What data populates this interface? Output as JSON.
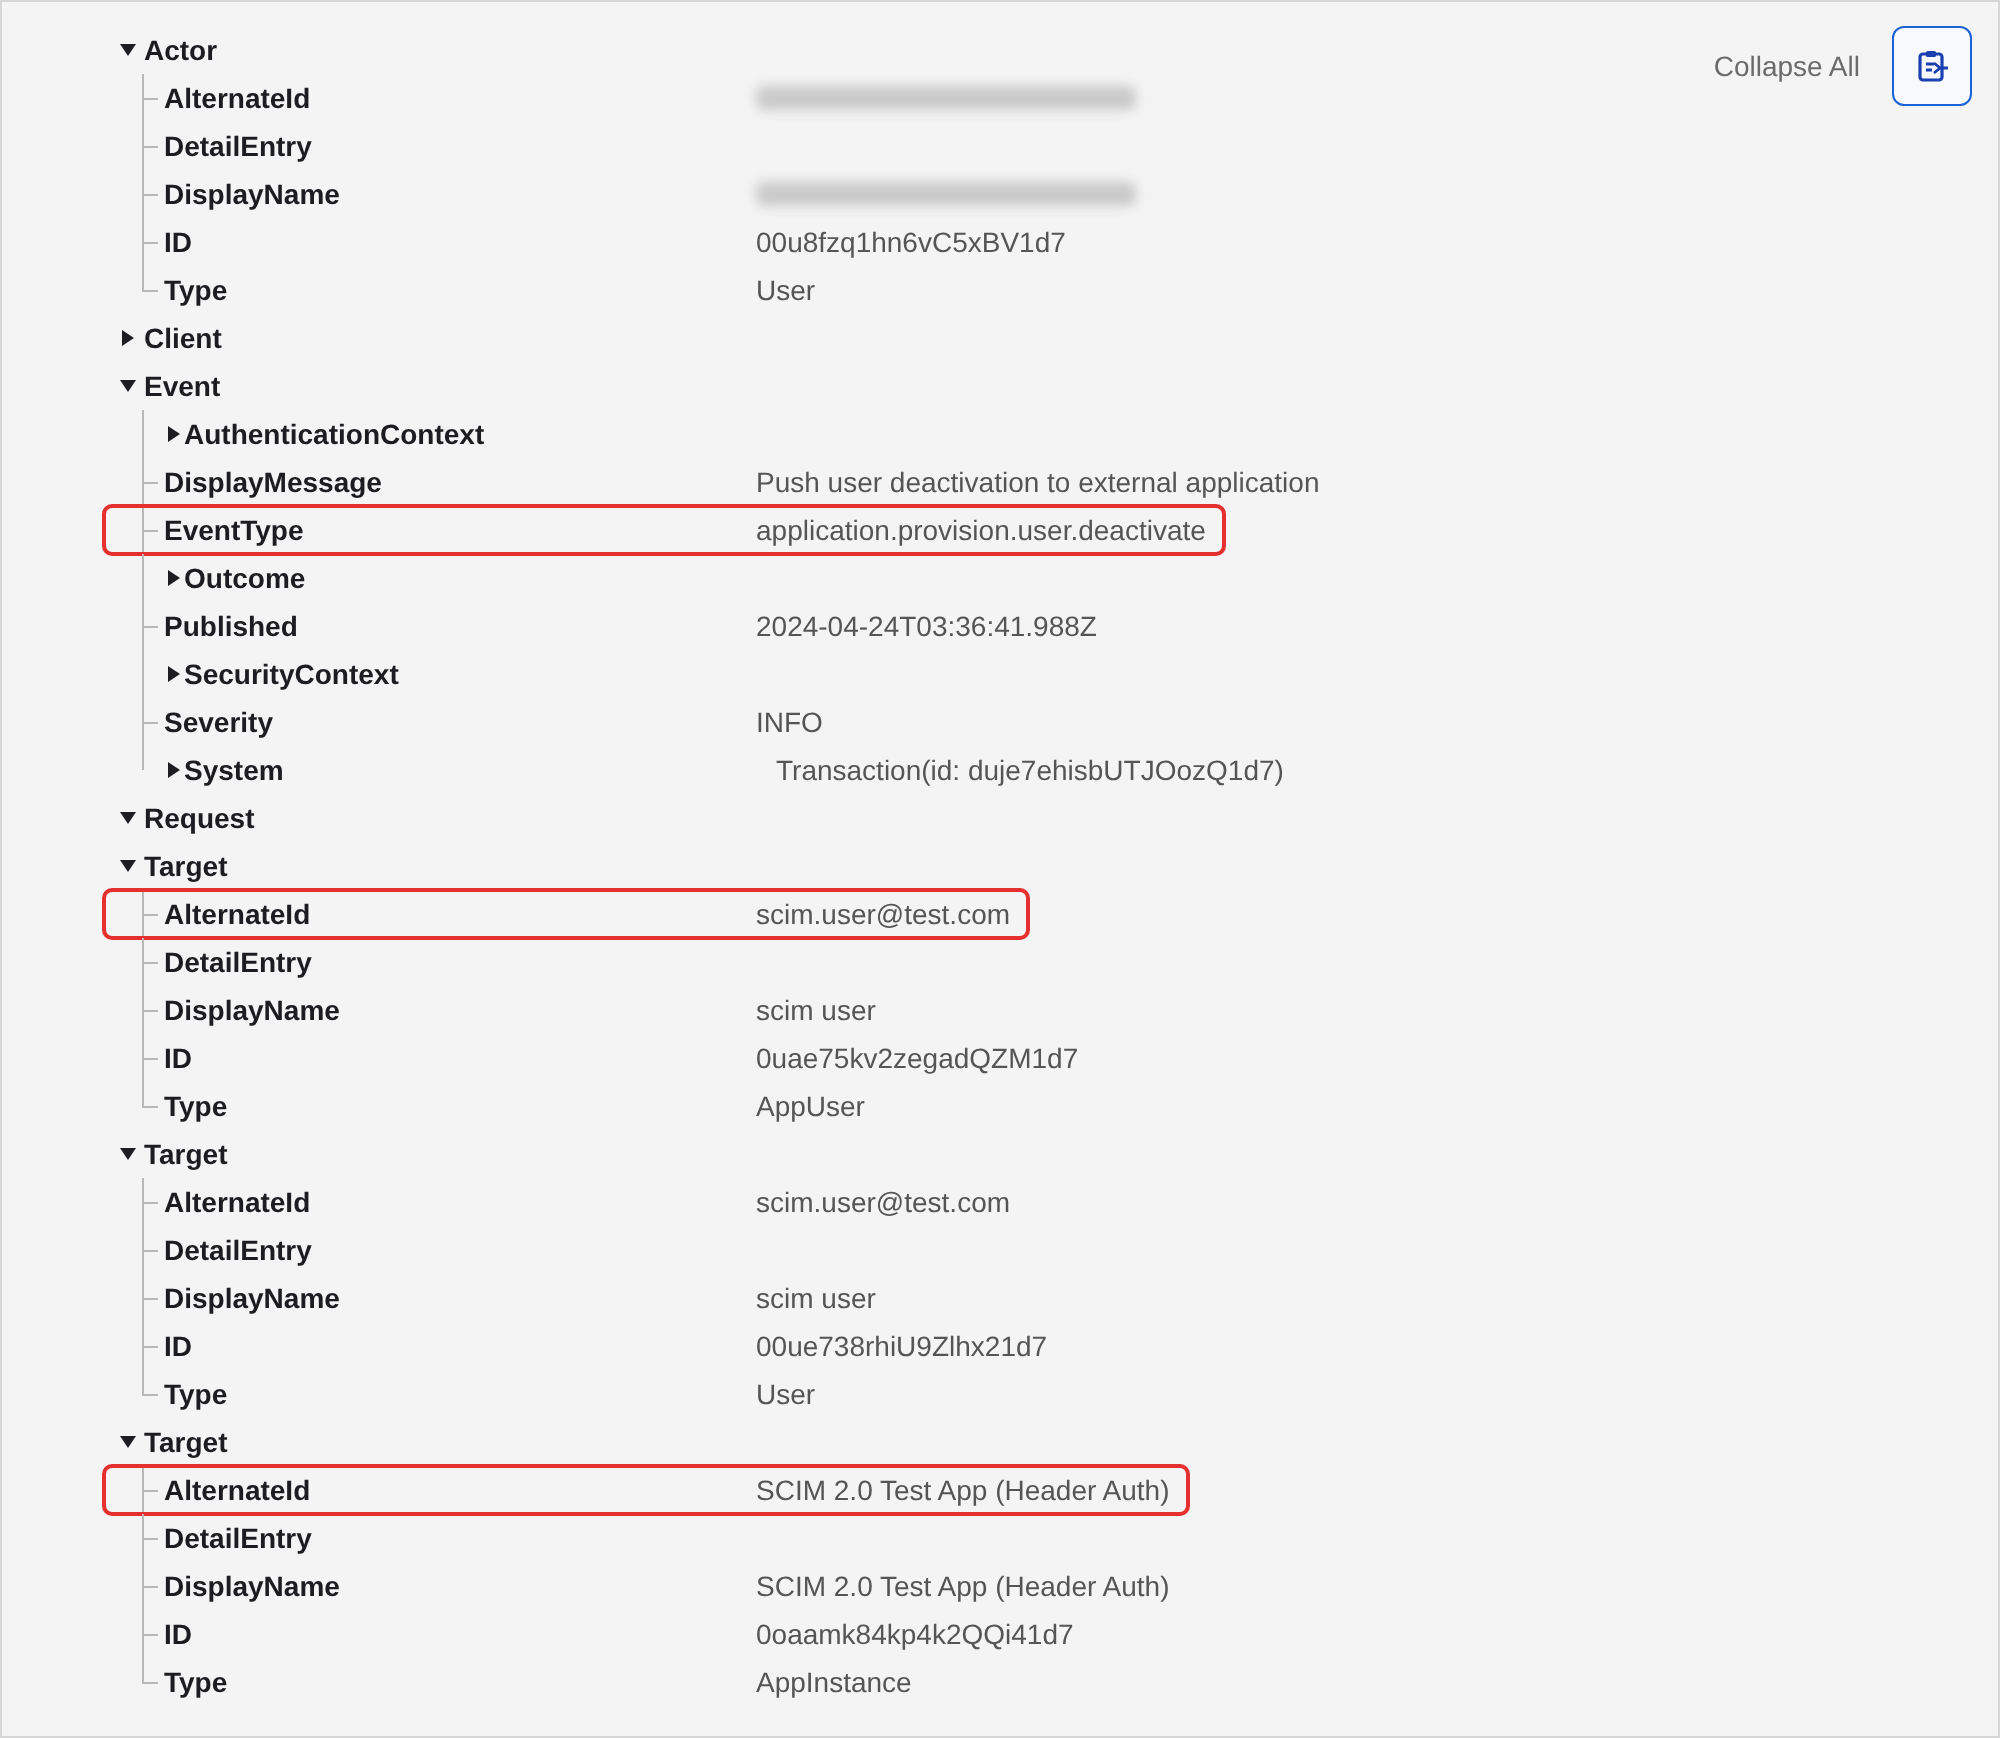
{
  "toolbar": {
    "collapse_link": "Collapse All"
  },
  "tree": [
    {
      "label": "Actor",
      "expanded": true,
      "children": [
        {
          "label": "AlternateId",
          "redacted": true
        },
        {
          "label": "DetailEntry"
        },
        {
          "label": "DisplayName",
          "redacted": true
        },
        {
          "label": "ID",
          "value": "00u8fzq1hn6vC5xBV1d7"
        },
        {
          "label": "Type",
          "value": "User"
        }
      ]
    },
    {
      "label": "Client",
      "expanded": false
    },
    {
      "label": "Event",
      "expanded": true,
      "children": [
        {
          "label": "AuthenticationContext",
          "expanded": false
        },
        {
          "label": "DisplayMessage",
          "value": "Push user deactivation to external application"
        },
        {
          "label": "EventType",
          "value": "application.provision.user.deactivate",
          "highlighted": true
        },
        {
          "label": "Outcome",
          "expanded": false
        },
        {
          "label": "Published",
          "value": "2024-04-24T03:36:41.988Z"
        },
        {
          "label": "SecurityContext",
          "expanded": false
        },
        {
          "label": "Severity",
          "value": "INFO"
        },
        {
          "label": "System",
          "expanded": false,
          "value": "Transaction(id: duje7ehisbUTJOozQ1d7)"
        }
      ]
    },
    {
      "label": "Request",
      "expanded": true
    },
    {
      "label": "Target",
      "expanded": true,
      "children": [
        {
          "label": "AlternateId",
          "value": "scim.user@test.com",
          "highlighted": true
        },
        {
          "label": "DetailEntry"
        },
        {
          "label": "DisplayName",
          "value": "scim user"
        },
        {
          "label": "ID",
          "value": "0uae75kv2zegadQZM1d7"
        },
        {
          "label": "Type",
          "value": "AppUser"
        }
      ]
    },
    {
      "label": "Target",
      "expanded": true,
      "children": [
        {
          "label": "AlternateId",
          "value": "scim.user@test.com"
        },
        {
          "label": "DetailEntry"
        },
        {
          "label": "DisplayName",
          "value": "scim user"
        },
        {
          "label": "ID",
          "value": "00ue738rhiU9Zlhx21d7"
        },
        {
          "label": "Type",
          "value": "User"
        }
      ]
    },
    {
      "label": "Target",
      "expanded": true,
      "children": [
        {
          "label": "AlternateId",
          "value": "SCIM 2.0 Test App (Header Auth)",
          "highlighted": true
        },
        {
          "label": "DetailEntry"
        },
        {
          "label": "DisplayName",
          "value": "SCIM 2.0 Test App (Header Auth)"
        },
        {
          "label": "ID",
          "value": "0oaamk84kp4k2QQi41d7"
        },
        {
          "label": "Type",
          "value": "AppInstance"
        }
      ]
    }
  ]
}
